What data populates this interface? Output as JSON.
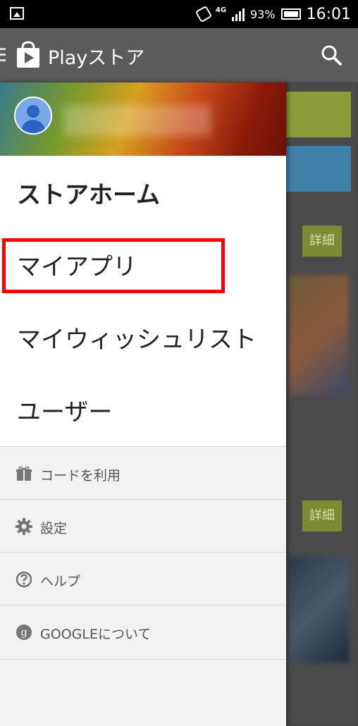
{
  "status_bar": {
    "network": "4G",
    "battery": "93%",
    "time": "16:01"
  },
  "app_bar": {
    "title": "Playストア"
  },
  "drawer": {
    "primary_items": [
      {
        "label": "ストアホーム"
      },
      {
        "label": "マイアプリ"
      },
      {
        "label": "マイウィッシュリスト"
      },
      {
        "label": "ユーザー"
      }
    ],
    "secondary_items": [
      {
        "label": "コードを利用",
        "icon": "gift-icon"
      },
      {
        "label": "設定",
        "icon": "gear-icon"
      },
      {
        "label": "ヘルプ",
        "icon": "help-icon"
      },
      {
        "label": "GOOGLEについて",
        "icon": "google-icon"
      }
    ]
  },
  "background": {
    "detail_label_1": "詳細",
    "detail_label_2": "詳細"
  },
  "colors": {
    "highlight": "#ff0000",
    "app_bar": "#5b5b5b",
    "detail_button": "#7c8a34"
  }
}
